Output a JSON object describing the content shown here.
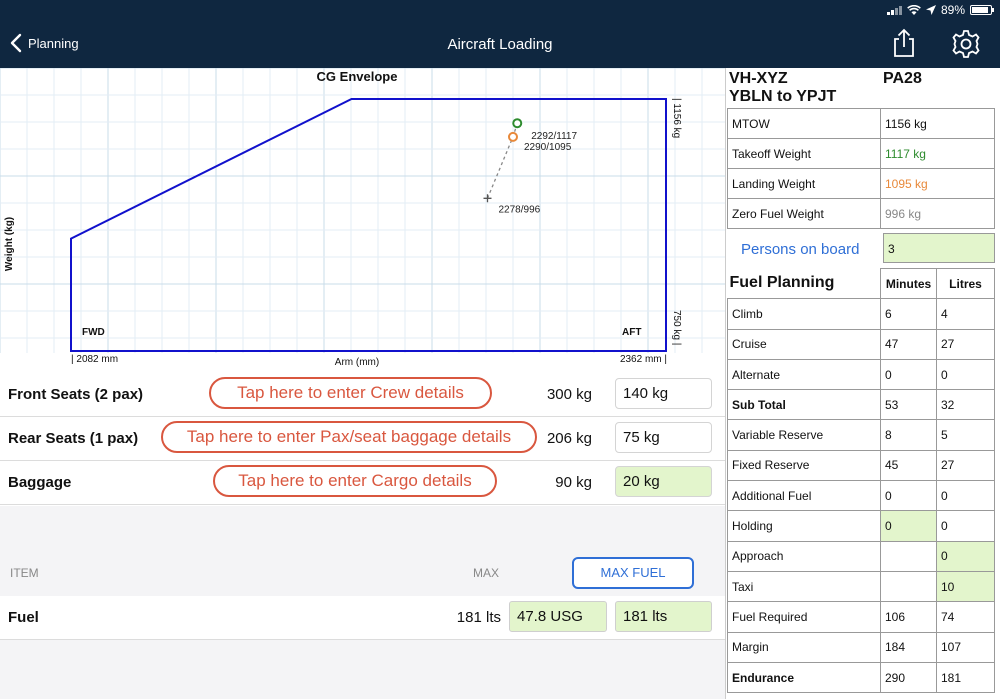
{
  "status": {
    "battery": "89%"
  },
  "nav": {
    "back_label": "Planning",
    "title": "Aircraft Loading"
  },
  "chart": {
    "title": "CG Envelope",
    "ylabel": "Weight (kg)",
    "xlabel": "Arm (mm)",
    "x_min_label": "| 2082 mm",
    "x_max_label": "2362 mm |",
    "y_max_label": "| 1156 kg",
    "y_min_label": "750 kg |",
    "fwd_label": "FWD",
    "aft_label": "AFT",
    "points": [
      {
        "label": "2292/1117",
        "color": "#2e8b2e"
      },
      {
        "label": "2290/1095",
        "color": "#e8893a"
      },
      {
        "label": "2278/996",
        "color": "#555555"
      }
    ]
  },
  "chart_data": {
    "type": "scatter",
    "title": "CG Envelope",
    "xlabel": "Arm (mm)",
    "ylabel": "Weight (kg)",
    "xlim": [
      2082,
      2362
    ],
    "ylim": [
      750,
      1156
    ],
    "envelope": [
      [
        2082,
        750
      ],
      [
        2082,
        931
      ],
      [
        2214,
        1156
      ],
      [
        2362,
        1156
      ],
      [
        2362,
        750
      ]
    ],
    "series": [
      {
        "name": "Takeoff",
        "x": [
          2292
        ],
        "y": [
          1117
        ]
      },
      {
        "name": "Landing",
        "x": [
          2290
        ],
        "y": [
          1095
        ]
      },
      {
        "name": "Zero Fuel",
        "x": [
          2278
        ],
        "y": [
          996
        ]
      }
    ]
  },
  "loading": {
    "rows": [
      {
        "label": "Front Seats (2 pax)",
        "hint": "Tap here to enter Crew details",
        "max": "300 kg",
        "value": "140 kg"
      },
      {
        "label": "Rear Seats (1 pax)",
        "hint": "Tap here to enter Pax/seat baggage details",
        "max": "206 kg",
        "value": "75 kg"
      },
      {
        "label": "Baggage",
        "hint": "Tap here to enter Cargo details",
        "max": "90 kg",
        "value": "20 kg"
      }
    ]
  },
  "fuel_section": {
    "item_header": "ITEM",
    "max_header": "MAX",
    "max_fuel_button": "MAX FUEL",
    "label": "Fuel",
    "max": "181 lts",
    "usg": "47.8 USG",
    "lts": "181 lts"
  },
  "summary": {
    "registration": "VH-XYZ",
    "route": "YBLN to YPJT",
    "aircraft_type": "PA28",
    "weights": [
      {
        "label": "MTOW",
        "value": "1156 kg",
        "color": "#111111"
      },
      {
        "label": "Takeoff Weight",
        "value": "1117 kg",
        "color": "#2e8b2e"
      },
      {
        "label": "Landing Weight",
        "value": "1095 kg",
        "color": "#e8893a"
      },
      {
        "label": "Zero Fuel Weight",
        "value": "996 kg",
        "color": "#888888"
      }
    ],
    "pob_label": "Persons on board",
    "pob_value": "3"
  },
  "fuel_planning": {
    "title": "Fuel Planning",
    "col_minutes": "Minutes",
    "col_litres": "Litres",
    "rows": [
      {
        "label": "Climb",
        "minutes": "6",
        "litres": "4"
      },
      {
        "label": "Cruise",
        "minutes": "47",
        "litres": "27"
      },
      {
        "label": "Alternate",
        "minutes": "0",
        "litres": "0"
      },
      {
        "label": "Sub Total",
        "minutes": "53",
        "litres": "32"
      },
      {
        "label": "Variable Reserve",
        "minutes": "8",
        "litres": "5"
      },
      {
        "label": "Fixed Reserve",
        "minutes": "45",
        "litres": "27"
      },
      {
        "label": "Additional Fuel",
        "minutes": "0",
        "litres": "0"
      },
      {
        "label": "Holding",
        "minutes": "0",
        "litres": "0"
      },
      {
        "label": "Approach",
        "minutes": "",
        "litres": "0"
      },
      {
        "label": "Taxi",
        "minutes": "",
        "litres": "10"
      },
      {
        "label": "Fuel Required",
        "minutes": "106",
        "litres": "74"
      },
      {
        "label": "Margin",
        "minutes": "184",
        "litres": "107"
      },
      {
        "label": "Endurance",
        "minutes": "290",
        "litres": "181"
      }
    ]
  }
}
